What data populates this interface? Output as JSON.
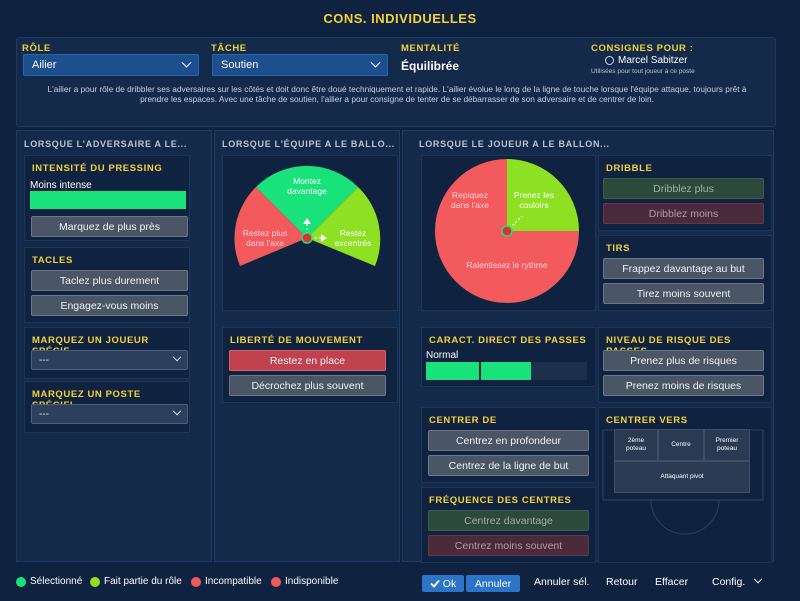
{
  "title": "CONS. INDIVIDUELLES",
  "top": {
    "role_label": "RÔLE",
    "role_value": "Ailier",
    "task_label": "TÂCHE",
    "task_value": "Soutien",
    "mentality_label": "MENTALITÉ",
    "mentality_value": "Équilibrée",
    "instructions_for_label": "CONSIGNES POUR :",
    "player_name": "Marcel Sabitzer",
    "player_sub": "Utilisées pour tout joueur à ce poste",
    "description": "L'ailier a pour rôle de dribbler ses adversaires sur les côtés et doit donc être doué techniquement et rapide. L'ailier évolue le long de la ligne de touche lorsque l'équipe attaque, toujours prêt à prendre les espaces. Avec une tâche de soutien, l'ailier a pour consigne de tenter de se débarrasser de son adversaire et de centrer de loin."
  },
  "col1": {
    "header": "LORSQUE L'ADVERSAIRE A LE...",
    "pressing_title": "INTENSITÉ DU PRESSING",
    "pressing_value": "Moins intense",
    "pressing_level": 1,
    "pressing_button": "Marquez de plus près",
    "tackles_title": "TACLES",
    "tackles_btn1": "Taclez plus durement",
    "tackles_btn2": "Engagez-vous moins",
    "mark_player_title": "MARQUEZ UN JOUEUR SPÉCIF...",
    "mark_player_value": "---",
    "mark_position_title": "MARQUEZ UN POSTE SPÉCIFI...",
    "mark_position_value": "---"
  },
  "col2": {
    "header": "LORSQUE L'ÉQUIPE A LE BALLO...",
    "seg_top": "Montez\ndavantage",
    "seg_left": "Restez plus\ndans l'axe",
    "seg_right": "Restez\nexcentrés",
    "freedom_title": "LIBERTÉ DE MOUVEMENT",
    "freedom_btn1": "Restez en place",
    "freedom_btn2": "Décrochez plus souvent"
  },
  "col3": {
    "header": "LORSQUE LE JOUEUR A LE BALLON...",
    "seg_left": "Repiquez\ndans l'axe",
    "seg_right": "Prenez les\ncouloirs",
    "seg_bottom": "Ralentissez le rythme",
    "passes_title": "CARACT. DIRECT DES PASSES",
    "passes_value": "Normal",
    "passes_level": 0.65,
    "cross_from_title": "CENTRER DE",
    "cross_from_btn1": "Centrez en profondeur",
    "cross_from_btn2": "Centrez de la ligne de but",
    "cross_freq_title": "FRÉQUENCE DES CENTRES",
    "cross_freq_btn1": "Centrez davantage",
    "cross_freq_btn2": "Centrez moins souvent"
  },
  "col4": {
    "dribble_title": "DRIBBLE",
    "dribble_btn1": "Dribblez plus",
    "dribble_btn2": "Dribblez moins",
    "shots_title": "TIRS",
    "shots_btn1": "Frappez davantage au but",
    "shots_btn2": "Tirez moins souvent",
    "risk_title": "NIVEAU DE RISQUE DES PASSES",
    "risk_btn1": "Prenez plus de risques",
    "risk_btn2": "Prenez moins de risques",
    "cross_to_title": "CENTRER VERS",
    "cross_to_near": "2ème\npoteau",
    "cross_to_centre": "Centre",
    "cross_to_far": "Premier\npoteau",
    "cross_to_striker": "Attaquant pivot"
  },
  "legend": {
    "selected": "Sélectionné",
    "in_role": "Fait partie du rôle",
    "incompatible": "Incompatible",
    "unavailable": "Indisponible"
  },
  "footer": {
    "ok": "Ok",
    "cancel": "Annuler",
    "cancel_sel": "Annuler sél.",
    "back": "Retour",
    "clear": "Effacer",
    "config": "Config."
  },
  "colors": {
    "selected": "#19e27a",
    "in_role": "#8ee023",
    "incompatible": "#f25a5e",
    "unavailable": "#f25a5e",
    "accent": "#f4d13a"
  },
  "icons": [
    "chevron-down-icon",
    "person-icon",
    "check-icon"
  ]
}
